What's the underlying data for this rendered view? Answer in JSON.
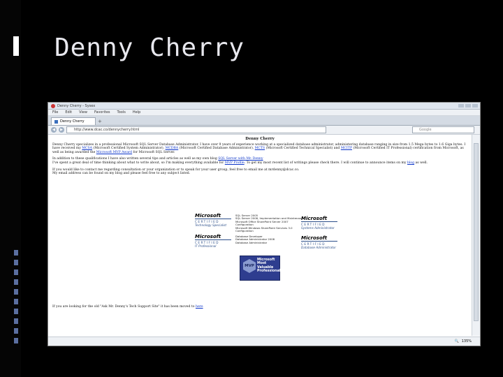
{
  "slide": {
    "title": "Denny Cherry"
  },
  "browser": {
    "window_title": "Denny Cherry - Sysex",
    "menu": [
      "File",
      "Edit",
      "View",
      "Favorites",
      "Tools",
      "Help"
    ],
    "tab_label": "Denny Cherry",
    "url": "http://www.dcac.co/dennycherry.html",
    "search_placeholder": "Google",
    "status_zoom": "135%"
  },
  "page": {
    "heading": "Denny Cherry",
    "intro_line1": "Denny Cherry specializes in a professional Microsoft SQL Server Database Administrator. I have over 9 years of experience working at a specialized database administrator, administering database ranging in size from 1.5 Mega bytes to 1.6 Giga bytes. I have received my",
    "link_mcsa": "MCSA",
    "intro_line2a": " (Microsoft Certified System Administrator), ",
    "link_mcdba": "MCDBA",
    "intro_line2b": " (Microsoft Certified Database Administrator), ",
    "link_mcts": "MCTS",
    "intro_line2c": " (Microsoft Certified Technical Specialist) and ",
    "link_mcitp": "MCITP",
    "intro_line2d": " (Microsoft Certified IT Professional) certification from Microsoft, as well as being awarded the",
    "link_mvp": "Microsoft MVP Award",
    "intro_line3": " for Microsoft SQL Server.",
    "para2a": "In addition to these qualifications I have also written several tips and articles as well as my own blog ",
    "link_blog": "SQL Server with Mr. Denny",
    "para2b": "I've spent a great deal of time thinking about what to write about, so I'm making everything available for ",
    "link_profile": "MVP Profile",
    "para2c": ". To get my most recent list of writings please check there. I will continue to announce items on my ",
    "link_blog2": "blog",
    "para2d": " as well.",
    "para3": "If you would like to contact me regarding consultation or your organization or to speak for your user group, feel free to email me at mrdenny@dcac.co.",
    "para4": "My email address can be found on my blog and please feel free to any subject listed.",
    "footer_text": "If you are looking for the old \"Ask Mr. Denny's Tech Support Site\" it has been moved to ",
    "footer_link": "here"
  },
  "certs": {
    "ms_logo": "Microsoft",
    "certified": "CERTIFIED",
    "badge1_sub": "Technology Specialist",
    "badge2_sub": "IT Professional",
    "badge3_sub": "Systems Administrator",
    "badge4_sub": "Database Administrator",
    "list1": [
      "SQL Server 2005",
      "SQL Server 2008, Implementation and Maintenance",
      "Microsoft Office SharePoint Server 2007",
      "Configuration",
      "Microsoft Windows SharePoint Services 3.0",
      "Configuration"
    ],
    "list2": [
      "Database Developer",
      "Database Administrator 2008",
      "Database Administrator"
    ],
    "mvp_label": "MVP",
    "mvp_text": [
      "Microsoft",
      "Most Valuable",
      "Professional"
    ]
  }
}
